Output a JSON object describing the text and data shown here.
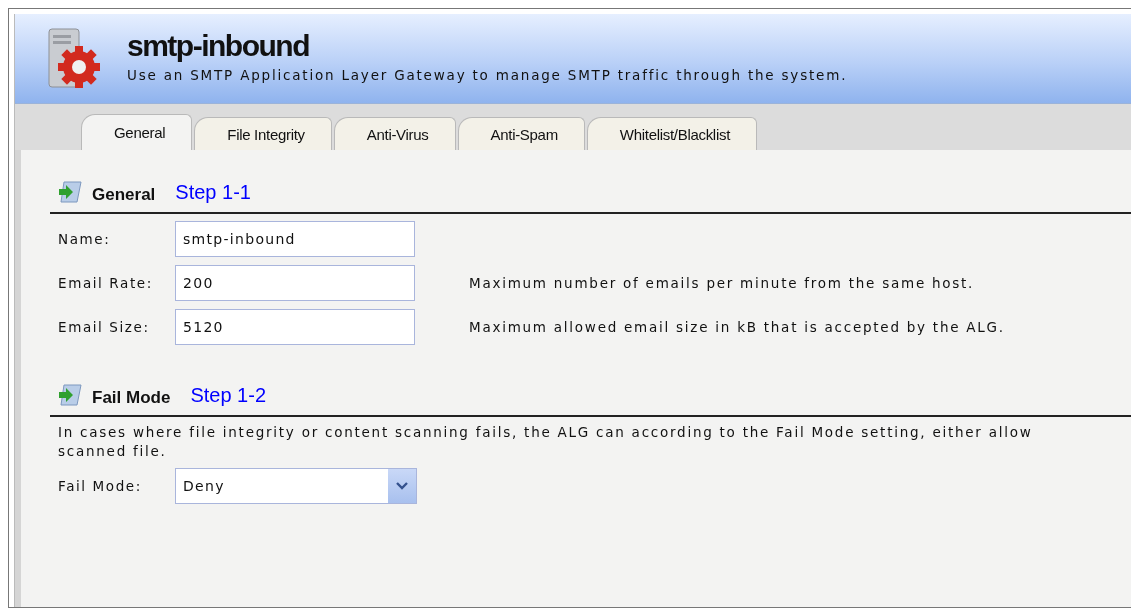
{
  "header": {
    "title": "smtp-inbound",
    "subtitle": "Use an SMTP Application Layer Gateway to manage SMTP traffic through the system."
  },
  "tabs": [
    {
      "label": "General",
      "selected": true
    },
    {
      "label": "File Integrity",
      "selected": false
    },
    {
      "label": "Anti-Virus",
      "selected": false
    },
    {
      "label": "Anti-Spam",
      "selected": false
    },
    {
      "label": "Whitelist/Blacklist",
      "selected": false
    }
  ],
  "sections": [
    {
      "title": "General",
      "annotation": "Step 1-1",
      "fields": [
        {
          "kind": "text",
          "label": "Name:",
          "value": "smtp-inbound"
        },
        {
          "kind": "text",
          "label": "Email Rate:",
          "value": "200",
          "hint": "Maximum number of emails per minute from the same host."
        },
        {
          "kind": "text",
          "label": "Email Size:",
          "value": "5120",
          "hint": "Maximum allowed email size in kB that is accepted by the ALG."
        }
      ]
    },
    {
      "title": "Fail Mode",
      "annotation": "Step 1-2",
      "description_lines": [
        "In cases where file integrity or content scanning fails, the ALG can according to the Fail Mode setting, either allow",
        "scanned file."
      ],
      "fields": [
        {
          "kind": "select",
          "label": "Fail Mode:",
          "value": "Deny"
        }
      ]
    }
  ]
}
